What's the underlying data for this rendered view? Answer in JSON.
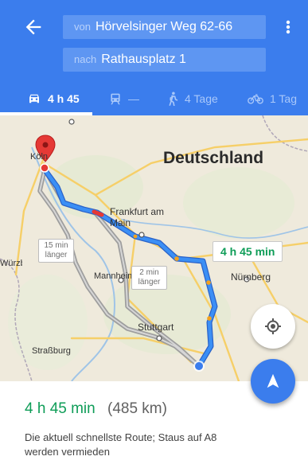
{
  "header": {
    "from_prefix": "von",
    "from_value": "Hörvelsinger Weg 62-66",
    "to_prefix": "nach",
    "to_value": "Rathausplatz 1"
  },
  "modes": [
    {
      "icon": "car-icon",
      "label": "4 h 45",
      "active": true
    },
    {
      "icon": "train-icon",
      "label": "—"
    },
    {
      "icon": "walk-icon",
      "label": "4 Tage"
    },
    {
      "icon": "bike-icon",
      "label": "1 Tag"
    }
  ],
  "map": {
    "country_label": "Deutschland",
    "cities": [
      "Köln",
      "Frankfurt am Main",
      "Nürnberg",
      "Mannheim",
      "Stuttgart",
      "Straßburg",
      "Würzburg"
    ],
    "alt_route_1": "15 min länger",
    "alt_route_2": "2 min länger",
    "main_route_label": "4 h 45 min",
    "route_color": "#3b7ded",
    "alt_route_color": "#9e9e9e"
  },
  "summary": {
    "time": "4 h 45 min",
    "distance": "(485 km)",
    "description": "Die aktuell schnellste Route; Staus auf A8 werden vermieden"
  },
  "colors": {
    "primary": "#3b7ded",
    "green": "#0f9d58",
    "traffic_red": "#e53935",
    "traffic_orange": "#f4a21e"
  }
}
